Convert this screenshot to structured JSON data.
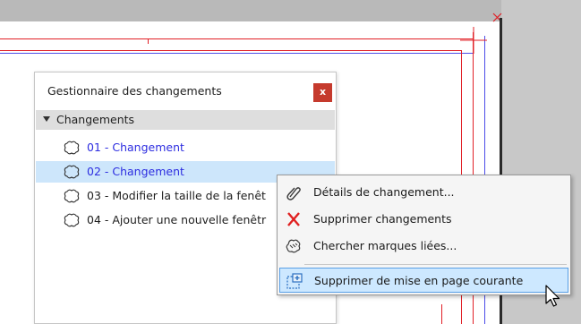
{
  "palette": {
    "title": "Gestionnaire des changements",
    "close_label": "x",
    "group_label": "Changements",
    "items": [
      {
        "label": "01 - Changement",
        "selected": false,
        "link": true
      },
      {
        "label": "02 - Changement",
        "selected": true,
        "link": true
      },
      {
        "label": "03 - Modifier la taille de la fenêt",
        "selected": false,
        "link": false
      },
      {
        "label": "04 - Ajouter une nouvelle fenêtr",
        "selected": false,
        "link": false
      }
    ]
  },
  "context_menu": {
    "items": [
      {
        "label": "Détails de changement...",
        "icon": "paperclip-icon"
      },
      {
        "label": "Supprimer changements",
        "icon": "red-x-icon"
      },
      {
        "label": "Chercher marques liées...",
        "icon": "linked-marks-icon"
      },
      {
        "label": "Supprimer de mise en page courante",
        "icon": "remove-from-layout-icon"
      }
    ]
  },
  "colors": {
    "drawing_red": "#e11f26",
    "drawing_blue": "#4d4de8",
    "close_button": "#c53a2d",
    "selection": "#cde6fb",
    "menu_hover_border": "#5aa0e6"
  }
}
